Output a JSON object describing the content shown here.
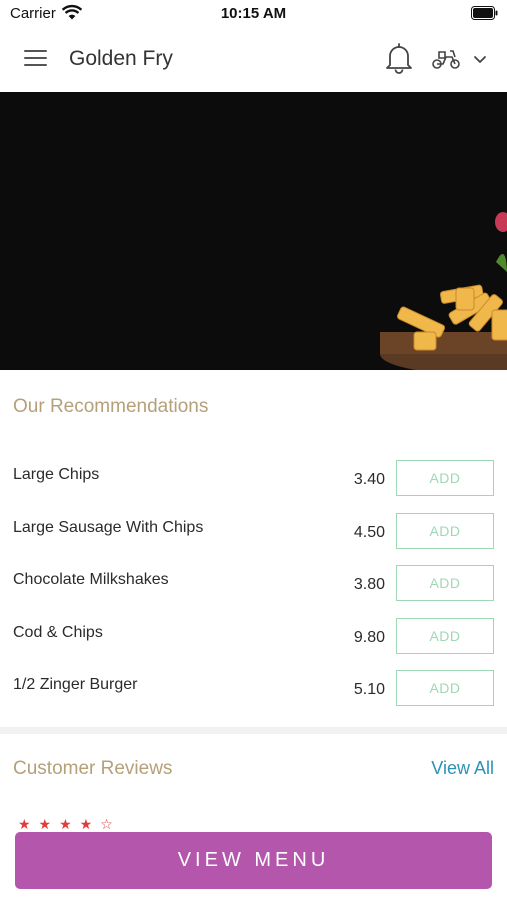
{
  "status_bar": {
    "carrier": "Carrier",
    "time": "10:15 AM"
  },
  "header": {
    "title": "Golden Fry"
  },
  "recommendations": {
    "title": "Our Recommendations",
    "items": [
      {
        "name": "Large Chips",
        "price": "3.40",
        "button": "ADD"
      },
      {
        "name": "Large Sausage With Chips",
        "price": "4.50",
        "button": "ADD"
      },
      {
        "name": "Chocolate Milkshakes",
        "price": "3.80",
        "button": "ADD"
      },
      {
        "name": "Cod & Chips",
        "price": "9.80",
        "button": "ADD"
      },
      {
        "name": "1/2 Zinger Burger",
        "price": "5.10",
        "button": "ADD"
      }
    ]
  },
  "reviews": {
    "title": "Customer Reviews",
    "view_all": "View All"
  },
  "footer": {
    "view_menu": "VIEW MENU"
  },
  "colors": {
    "accent": "#b456ac",
    "section_title": "#b5a07a",
    "add_button": "#9fd8b5",
    "link": "#2a93b7",
    "star": "#e23b3b"
  }
}
